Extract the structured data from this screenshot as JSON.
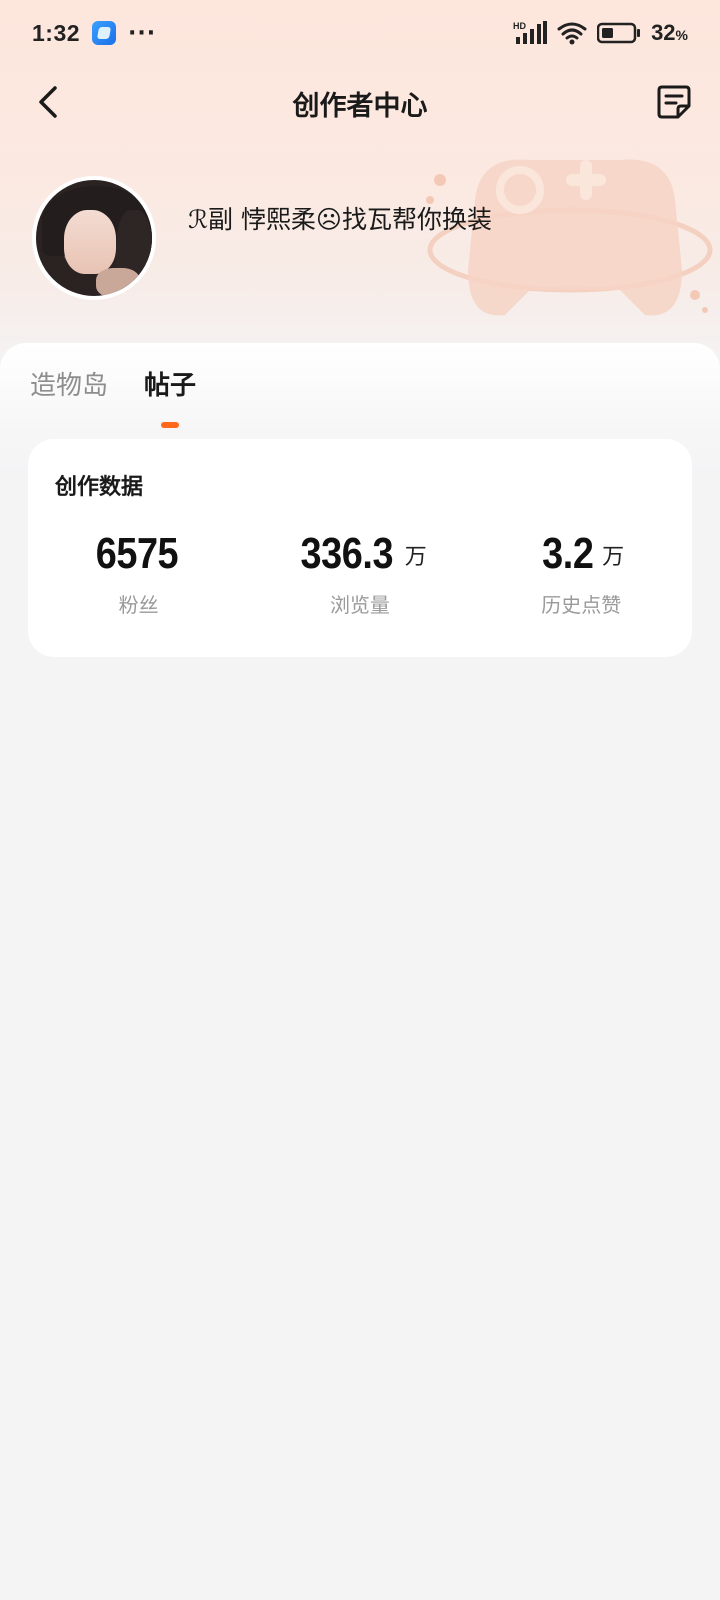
{
  "status_bar": {
    "time": "1:32",
    "more": "···",
    "battery_percent": "32",
    "battery_unit": "%",
    "network_label": "HD"
  },
  "nav": {
    "title": "创作者中心"
  },
  "profile": {
    "username": "ℛ副 悖熙柔☹找瓦帮你换装"
  },
  "tabs": [
    {
      "label": "造物岛",
      "active": false
    },
    {
      "label": "帖子",
      "active": true
    }
  ],
  "stats_card": {
    "title": "创作数据",
    "items": [
      {
        "value": "6575",
        "unit": "",
        "label": "粉丝"
      },
      {
        "value": "336.3",
        "unit": "万",
        "label": "浏览量"
      },
      {
        "value": "3.2",
        "unit": "万",
        "label": "历史点赞"
      }
    ]
  },
  "colors": {
    "accent": "#ff6a1a",
    "header_bg": "#fde6dc"
  }
}
